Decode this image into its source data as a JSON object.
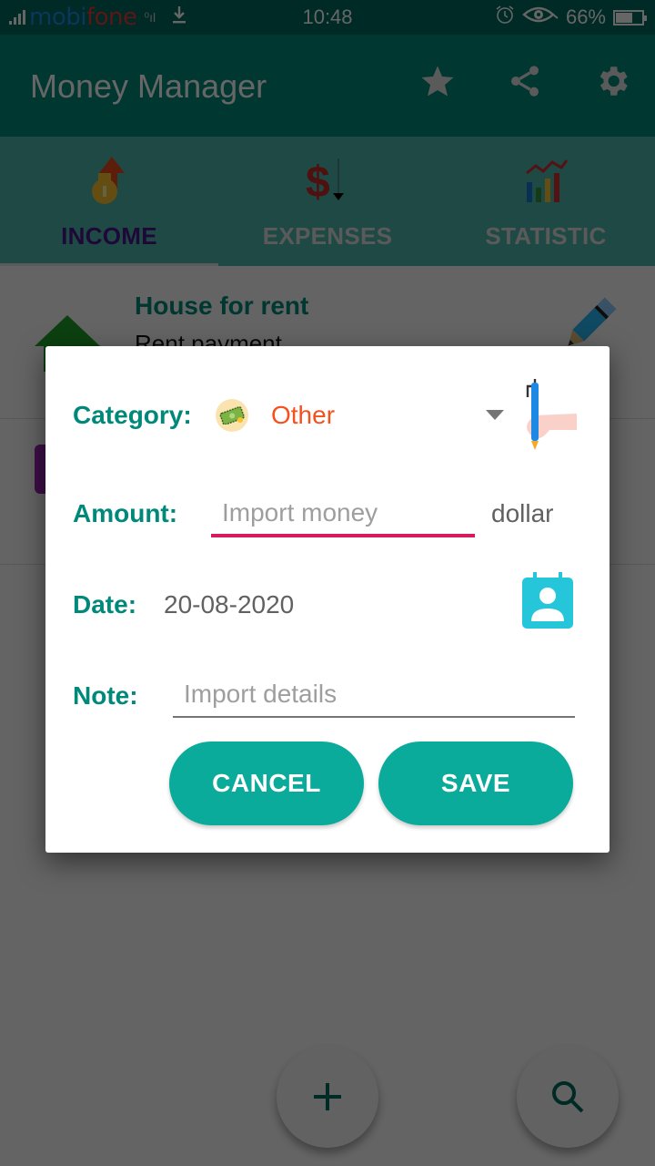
{
  "status_bar": {
    "carrier_part1": "mobi",
    "carrier_part2": "fone",
    "time": "10:48",
    "battery_percent": "66%",
    "battery_level": 0.66,
    "icons": [
      "signal-icon",
      "data-signal-icon",
      "download-icon",
      "alarm-icon",
      "eye-comfort-icon",
      "battery-icon"
    ]
  },
  "app_bar": {
    "title": "Money Manager",
    "actions": [
      {
        "name": "favorite",
        "icon": "star-icon"
      },
      {
        "name": "share",
        "icon": "share-icon"
      },
      {
        "name": "settings",
        "icon": "gear-icon"
      }
    ]
  },
  "tabs": [
    {
      "label": "INCOME",
      "icon": "money-bag-up-icon",
      "active": true
    },
    {
      "label": "EXPENSES",
      "icon": "dollar-down-icon",
      "active": false
    },
    {
      "label": "STATISTIC",
      "icon": "chart-icon",
      "active": false
    }
  ],
  "list": {
    "items": [
      {
        "title": "House for rent",
        "subtitle": "Rent payment",
        "type_icon": "up-arrow-icon",
        "action_icon": "pencil-icon"
      }
    ]
  },
  "dialog": {
    "category_label": "Category:",
    "category_value": "Other",
    "category_icon": "banknote-icon",
    "amount_label": "Amount:",
    "amount_value": "",
    "amount_placeholder": "Import money",
    "currency": "dollar",
    "date_label": "Date:",
    "date_value": "20-08-2020",
    "note_label": "Note:",
    "note_value": "",
    "note_placeholder": "Import details",
    "cancel_label": "CANCEL",
    "save_label": "SAVE"
  },
  "colors": {
    "primary": "#00897b",
    "primary_dark": "#00695c",
    "accent": "#d81b60",
    "button": "#0aab9b",
    "category_value": "#f4511e"
  }
}
